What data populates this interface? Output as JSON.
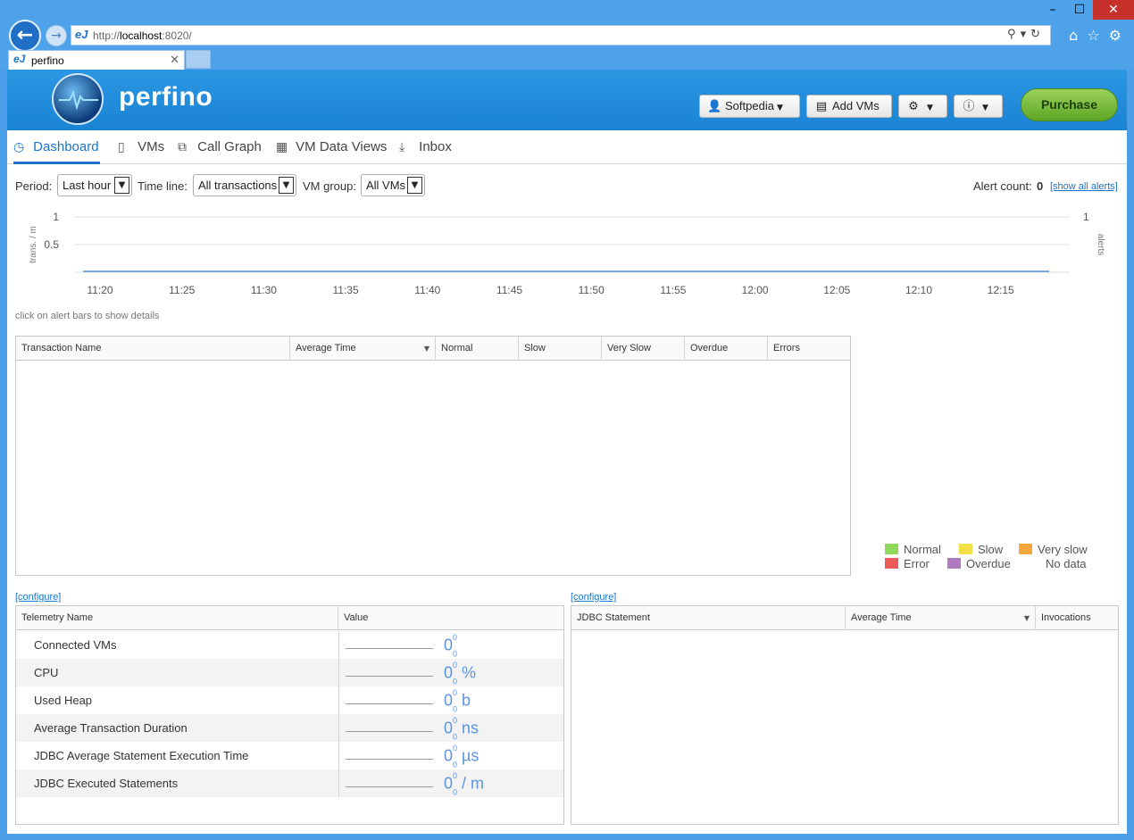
{
  "browser": {
    "url_prefix": "http://",
    "url_host": "localhost",
    "url_suffix": ":8020/",
    "tab_title": "perfino",
    "ej": "eJ"
  },
  "header": {
    "logo": "perfino",
    "buttons": {
      "user": "Softpedia",
      "add_vms": "Add VMs",
      "purchase": "Purchase"
    }
  },
  "nav": {
    "dashboard": "Dashboard",
    "vms": "VMs",
    "call_graph": "Call Graph",
    "vm_data_views": "VM Data Views",
    "inbox": "Inbox"
  },
  "filters": {
    "period_label": "Period:",
    "period_value": "Last hour",
    "timeline_label": "Time line:",
    "timeline_value": "All transactions",
    "vmgroup_label": "VM group:",
    "vmgroup_value": "All VMs",
    "alert_label": "Alert count:",
    "alert_count": "0",
    "show_alerts": "[show all alerts]"
  },
  "chart_data": {
    "type": "line",
    "x": [
      "11:20",
      "11:25",
      "11:30",
      "11:35",
      "11:40",
      "11:45",
      "11:50",
      "11:55",
      "12:00",
      "12:05",
      "12:10",
      "12:15"
    ],
    "series": [
      {
        "values": [
          0,
          0,
          0,
          0,
          0,
          0,
          0,
          0,
          0,
          0,
          0,
          0
        ]
      }
    ],
    "ylabel": "trans. / m",
    "y2label": "alerts",
    "yticks": [
      "0.5",
      "1"
    ],
    "y2ticks": [
      "1"
    ],
    "ylim": [
      0,
      1
    ],
    "color": "#3a78d6"
  },
  "hint": "click on alert bars to show details",
  "transactions_table": {
    "columns": [
      "Transaction Name",
      "Average Time",
      "Normal",
      "Slow",
      "Very Slow",
      "Overdue",
      "Errors"
    ]
  },
  "legend": [
    {
      "label": "Normal",
      "color": "#8fd85a"
    },
    {
      "label": "Slow",
      "color": "#f4e04a"
    },
    {
      "label": "Very slow",
      "color": "#f4a73a"
    },
    {
      "label": "Error",
      "color": "#ec5b5b"
    },
    {
      "label": "Overdue",
      "color": "#b07ac0"
    },
    {
      "label": "No data",
      "color": ""
    }
  ],
  "configure": "[configure]",
  "telemetry_table": {
    "columns": [
      "Telemetry Name",
      "Value"
    ],
    "rows": [
      {
        "name": "Connected VMs",
        "value": "0",
        "sup": "0",
        "sub": "0",
        "unit": ""
      },
      {
        "name": "CPU",
        "value": "0",
        "sup": "0",
        "sub": "0",
        "unit": "%"
      },
      {
        "name": "Used Heap",
        "value": "0",
        "sup": "0",
        "sub": "0",
        "unit": "b"
      },
      {
        "name": "Average Transaction Duration",
        "value": "0",
        "sup": "0",
        "sub": "0",
        "unit": "ns"
      },
      {
        "name": "JDBC Average Statement Execution Time",
        "value": "0",
        "sup": "0",
        "sub": "0",
        "unit": "µs"
      },
      {
        "name": "JDBC Executed Statements",
        "value": "0",
        "sup": "0",
        "sub": "0",
        "unit": "/ m"
      }
    ]
  },
  "jdbc_table": {
    "columns": [
      "JDBC Statement",
      "Average Time",
      "Invocations"
    ]
  }
}
